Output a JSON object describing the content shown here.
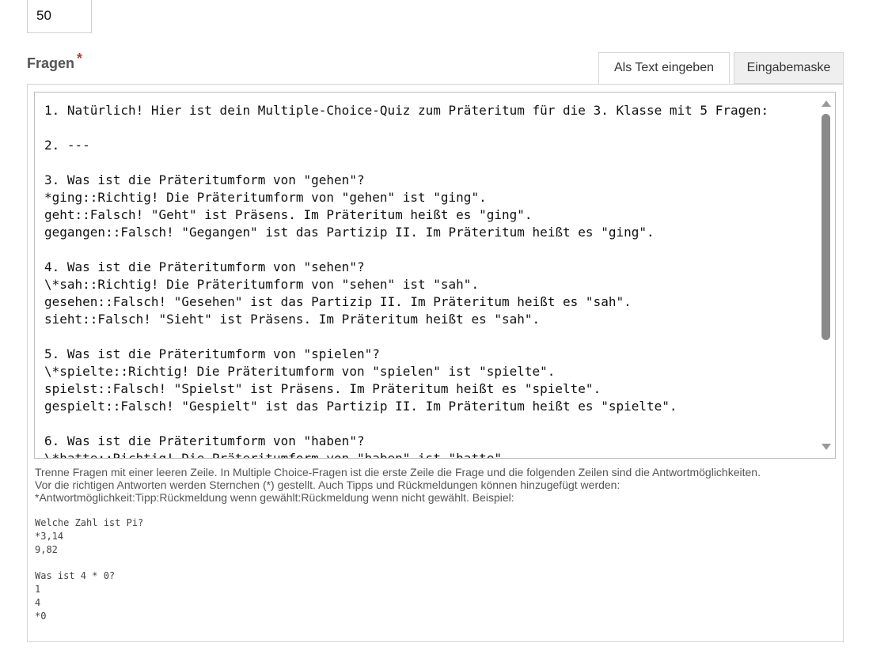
{
  "number_field": {
    "value": "50"
  },
  "questions_field": {
    "label": "Fragen",
    "required_marker": "*"
  },
  "tabs": [
    {
      "label": "Als Text eingeben",
      "active": true
    },
    {
      "label": "Eingabemaske",
      "active": false
    }
  ],
  "editor": {
    "content": "1. Natürlich! Hier ist dein Multiple-Choice-Quiz zum Präteritum für die 3. Klasse mit 5 Fragen:\n\n2. ---\n\n3. Was ist die Präteritumform von \"gehen\"?\n*ging::Richtig! Die Präteritumform von \"gehen\" ist \"ging\".\ngeht::Falsch! \"Geht\" ist Präsens. Im Präteritum heißt es \"ging\".\ngegangen::Falsch! \"Gegangen\" ist das Partizip II. Im Präteritum heißt es \"ging\".\n\n4. Was ist die Präteritumform von \"sehen\"?\n\\*sah::Richtig! Die Präteritumform von \"sehen\" ist \"sah\".\ngesehen::Falsch! \"Gesehen\" ist das Partizip II. Im Präteritum heißt es \"sah\".\nsieht::Falsch! \"Sieht\" ist Präsens. Im Präteritum heißt es \"sah\".\n\n5. Was ist die Präteritumform von \"spielen\"?\n\\*spielte::Richtig! Die Präteritumform von \"spielen\" ist \"spielte\".\nspielst::Falsch! \"Spielst\" ist Präsens. Im Präteritum heißt es \"spielte\".\ngespielt::Falsch! \"Gespielt\" ist das Partizip II. Im Präteritum heißt es \"spielte\".\n\n6. Was ist die Präteritumform von \"haben\"?\n\\*hatte::Richtig! Die Präteritumform von \"haben\" ist \"hatte\"."
  },
  "help": {
    "line1": "Trenne Fragen mit einer leeren Zeile. In Multiple Choice-Fragen ist die erste Zeile die Frage und die folgenden Zeilen sind die Antwortmöglichkeiten.",
    "line2": "Vor die richtigen Antworten werden Sternchen (*) gestellt. Auch Tipps und Rückmeldungen können hinzugefügt werden:",
    "line3": "*Antwortmöglichkeit:Tipp:Rückmeldung wenn gewählt:Rückmeldung wenn nicht gewählt. Beispiel:",
    "example": "Welche Zahl ist Pi?\n*3,14\n9,82\n\nWas ist 4 * 0?\n1\n4\n*0"
  },
  "icons": {
    "scroll_up": "triangle-up",
    "scroll_down": "triangle-down"
  }
}
